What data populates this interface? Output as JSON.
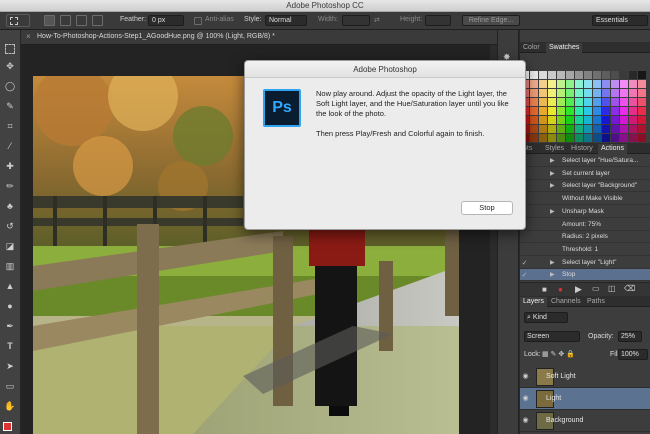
{
  "window": {
    "title": "Adobe Photoshop CC"
  },
  "options_bar": {
    "feather_label": "Feather:",
    "feather_value": "0 px",
    "anti_alias_label": "Anti-alias",
    "style_label": "Style:",
    "style_value": "Normal",
    "width_label": "Width:",
    "height_label": "Height:",
    "refine_edge_label": "Refine Edge...",
    "workspace_value": "Essentials"
  },
  "document": {
    "tab_label": "How-To-Photoshop-Actions-Step1_AGoodHue.png @ 100% (Light, RGB/8) *"
  },
  "color_panel": {
    "tabs": [
      "Color",
      "Swatches"
    ],
    "active_tab": "Swatches"
  },
  "actions_panel": {
    "tabs": [
      "nts",
      "Styles",
      "History",
      "Actions"
    ],
    "active_tab": "Actions",
    "rows": [
      {
        "text": "Select layer \"Hue/Satura...",
        "checked": true
      },
      {
        "text": "Set current layer",
        "checked": true
      },
      {
        "text": "Select layer \"Background\"",
        "checked": true
      },
      {
        "text": "Without Make Visible",
        "checked": false
      },
      {
        "text": "Unsharp Mask",
        "checked": true
      },
      {
        "text": "Amount: 75%",
        "checked": false
      },
      {
        "text": "Radius: 2 pixels",
        "checked": false
      },
      {
        "text": "Threshold: 1",
        "checked": false
      },
      {
        "text": "Select layer \"Light\"",
        "checked": true
      },
      {
        "text": "Stop",
        "checked": true
      }
    ]
  },
  "layers_panel": {
    "tabs": [
      "Layers",
      "Channels",
      "Paths"
    ],
    "active_tab": "Layers",
    "kind_label": "Kind",
    "blend_mode": "Screen",
    "opacity_label": "Opacity:",
    "opacity_value": "25%",
    "lock_label": "Lock:",
    "fill_label": "Fill:",
    "fill_value": "100%",
    "layers": [
      {
        "name": "Soft Light",
        "selected": false
      },
      {
        "name": "Light",
        "selected": true
      },
      {
        "name": "Background",
        "selected": false
      }
    ]
  },
  "dialog": {
    "title": "Adobe Photoshop",
    "logo_text": "Ps",
    "message_1": "Now play around. Adjust the opacity of the Light layer, the Soft Light layer, and the Hue/Saturation layer until you like the look of the photo.",
    "message_2": "Then press Play/Fresh and Colorful again to finish.",
    "stop_button": "Stop"
  },
  "colors": {
    "accent_selected": "#5b7291",
    "ps_blue": "#31a8ff"
  }
}
